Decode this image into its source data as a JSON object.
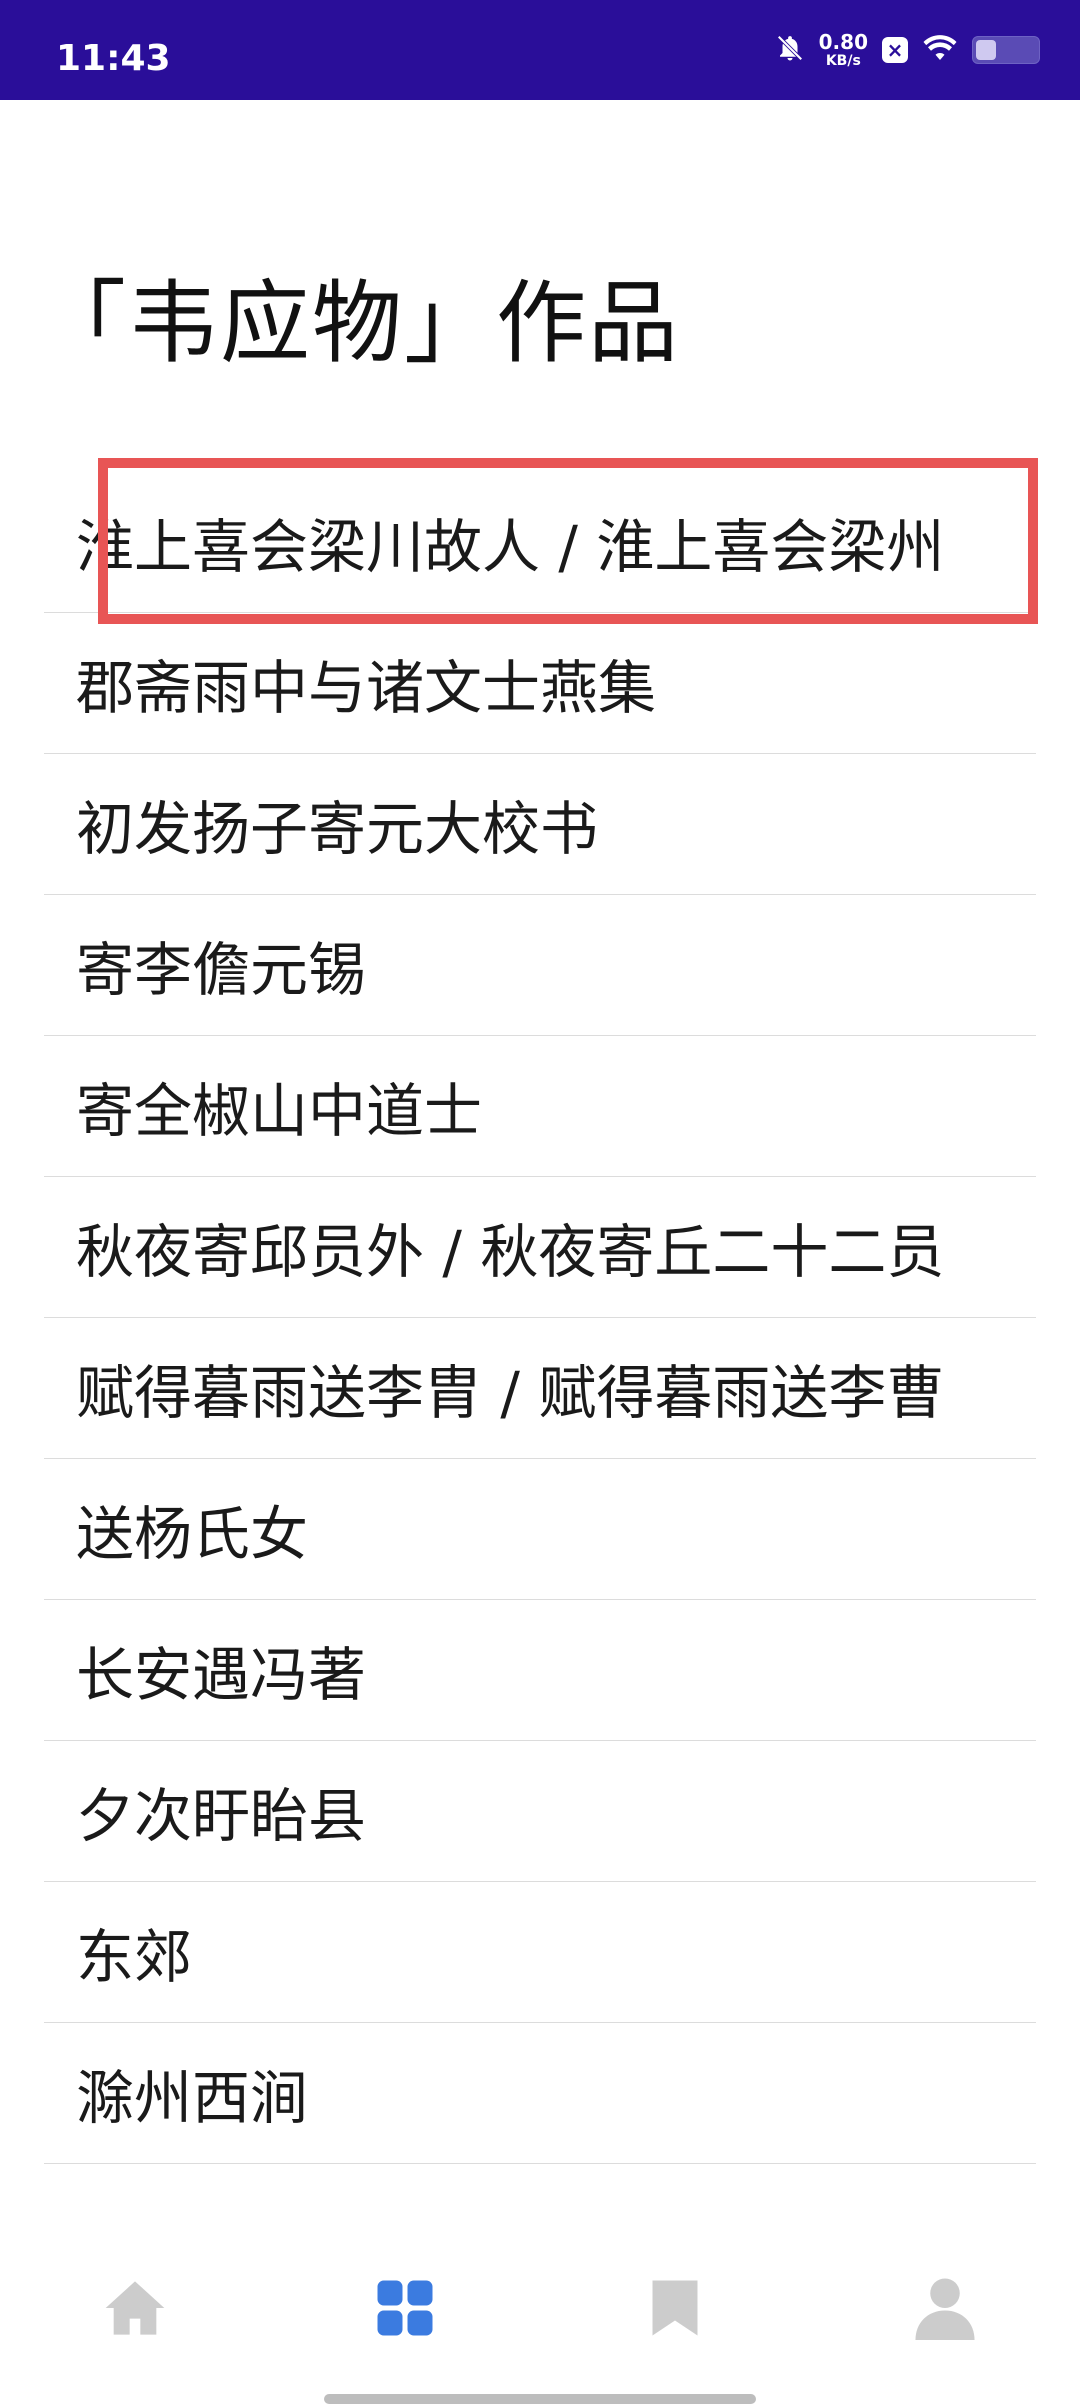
{
  "status_bar": {
    "time": "11:43",
    "speed_value": "0.80",
    "speed_unit": "KB/s",
    "icons": [
      "mute-bell-icon",
      "speed-indicator",
      "close-box-icon",
      "wifi-icon",
      "battery-icon"
    ],
    "background": "#2a0e99"
  },
  "page": {
    "title": "「韦应物」作品"
  },
  "works": [
    "淮上喜会梁川故人 / 淮上喜会梁州",
    "郡斋雨中与诸文士燕集",
    "初发扬子寄元大校书",
    "寄李儋元锡",
    "寄全椒山中道士",
    "秋夜寄邱员外 / 秋夜寄丘二十二员",
    "赋得暮雨送李胄 / 赋得暮雨送李曹",
    "送杨氏女",
    "长安遇冯著",
    "夕次盱眙县",
    "东郊",
    "滁州西涧"
  ],
  "highlight_color": "#e85555",
  "bottom_nav": {
    "items": [
      "home-icon",
      "grid-icon",
      "bookmark-icon",
      "profile-icon"
    ],
    "active_index": 1,
    "active_color": "#3b7be0",
    "inactive_color": "#cccccc"
  }
}
